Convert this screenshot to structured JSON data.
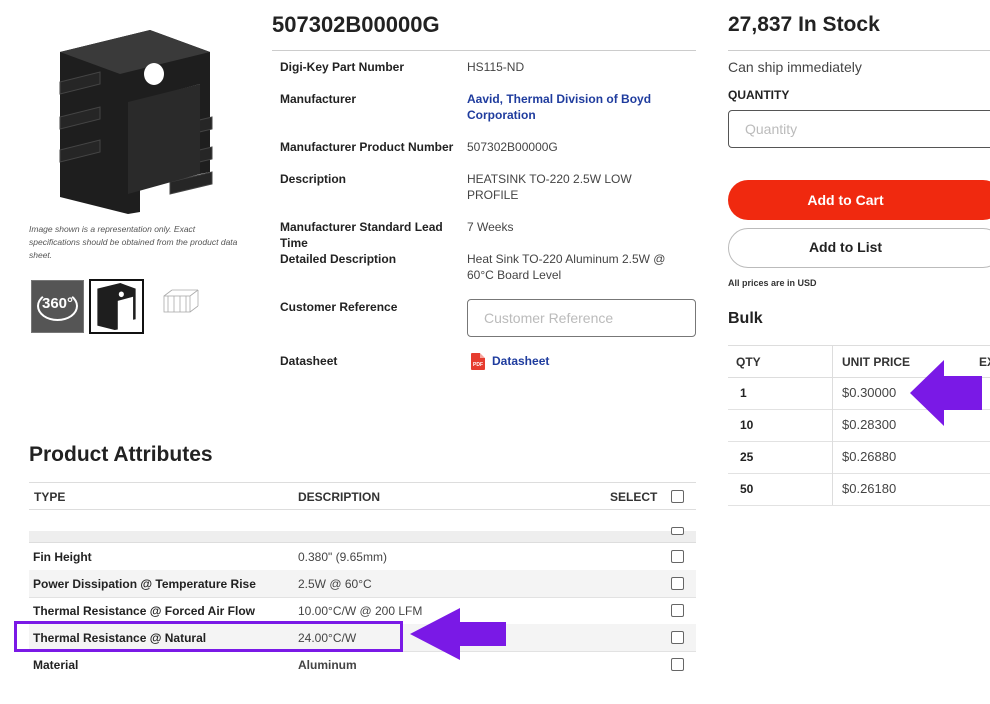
{
  "product": {
    "part_number": "507302B00000G",
    "image_disclaimer": "Image shown is a representation only. Exact specifications should be obtained from the product data sheet.",
    "thumbnail_360_label": "360°"
  },
  "details": [
    {
      "label": "Digi-Key Part Number",
      "value": "HS115-ND"
    },
    {
      "label": "Manufacturer",
      "value": "Aavid, Thermal Division of Boyd Corporation"
    },
    {
      "label": "Manufacturer Product Number",
      "value": "507302B00000G"
    },
    {
      "label": "Description",
      "value": "HEATSINK TO-220 2.5W LOW PROFILE"
    },
    {
      "label": "Manufacturer Standard Lead Time",
      "value": "7 Weeks"
    },
    {
      "label": "Detailed Description",
      "value": "Heat Sink TO-220 Aluminum 2.5W @ 60°C Board Level"
    },
    {
      "label": "Customer Reference",
      "placeholder": "Customer Reference"
    },
    {
      "label": "Datasheet",
      "value": "Datasheet"
    }
  ],
  "attributes": {
    "heading": "Product Attributes",
    "columns": {
      "type": "TYPE",
      "description": "DESCRIPTION",
      "select": "SELECT"
    },
    "rows": [
      {
        "type": "Fin Height",
        "description": "0.380\" (9.65mm)"
      },
      {
        "type": "Power Dissipation @ Temperature Rise",
        "description": "2.5W @ 60°C"
      },
      {
        "type": "Thermal Resistance @ Forced Air Flow",
        "description": "10.00°C/W @ 200 LFM"
      },
      {
        "type": "Thermal Resistance @ Natural",
        "description": "24.00°C/W"
      },
      {
        "type": "Material",
        "description": "Aluminum"
      }
    ]
  },
  "purchase": {
    "stock": "27,837 In Stock",
    "ship_text": "Can ship immediately",
    "quantity_label": "QUANTITY",
    "quantity_placeholder": "Quantity",
    "add_to_cart": "Add to Cart",
    "add_to_list": "Add to List",
    "currency_note": "All prices are in USD",
    "bulk_label": "Bulk",
    "price_columns": {
      "qty": "QTY",
      "unit_price": "UNIT PRICE",
      "extended": "EX"
    },
    "price_breaks": [
      {
        "qty": "1",
        "price": "$0.30000"
      },
      {
        "qty": "10",
        "price": "$0.28300"
      },
      {
        "qty": "25",
        "price": "$0.26880"
      },
      {
        "qty": "50",
        "price": "$0.26180"
      }
    ]
  },
  "colors": {
    "accent_red": "#f0290f",
    "link_blue": "#1f3c9e",
    "annotation_purple": "#7a19e6"
  }
}
